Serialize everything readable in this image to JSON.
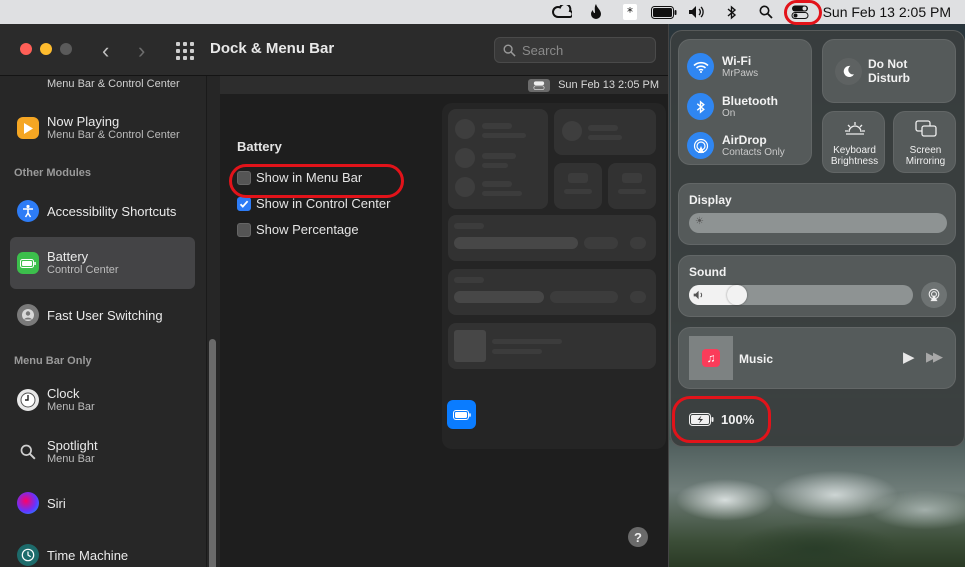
{
  "menubar": {
    "clock": "Sun Feb 13  2:05 PM",
    "icons": [
      "creative-cloud-icon",
      "flame-icon",
      "asterisk-icon",
      "battery-icon",
      "volume-icon",
      "bluetooth-icon",
      "search-icon",
      "control-center-icon"
    ]
  },
  "window": {
    "title": "Dock & Menu Bar",
    "search_placeholder": "Search"
  },
  "sidebar": {
    "items": [
      {
        "title": "",
        "subtitle": "Menu Bar & Control Center",
        "icon": "generic-icon"
      },
      {
        "title": "Now Playing",
        "subtitle": "Menu Bar & Control Center",
        "icon": "play-icon"
      },
      {
        "title": "Accessibility Shortcuts",
        "subtitle": "",
        "icon": "accessibility-icon"
      },
      {
        "title": "Battery",
        "subtitle": "Control Center",
        "icon": "battery-icon"
      },
      {
        "title": "Fast User Switching",
        "subtitle": "",
        "icon": "user-icon"
      },
      {
        "title": "Clock",
        "subtitle": "Menu Bar",
        "icon": "clock-icon"
      },
      {
        "title": "Spotlight",
        "subtitle": "Menu Bar",
        "icon": "search-icon"
      },
      {
        "title": "Siri",
        "subtitle": "",
        "icon": "siri-icon"
      },
      {
        "title": "Time Machine",
        "subtitle": "",
        "icon": "time-machine-icon"
      }
    ],
    "headers": {
      "other_modules": "Other Modules",
      "menu_bar_only": "Menu Bar Only"
    },
    "selected": "Battery"
  },
  "main": {
    "preview_clock": "Sun Feb 13  2:05 PM",
    "section_title": "Battery",
    "options": [
      {
        "label": "Show in Menu Bar",
        "checked": false
      },
      {
        "label": "Show in Control Center",
        "checked": true
      },
      {
        "label": "Show Percentage",
        "checked": false
      }
    ],
    "help": "?"
  },
  "control_center": {
    "wifi": {
      "title": "Wi-Fi",
      "sub": "MrPaws"
    },
    "bluetooth": {
      "title": "Bluetooth",
      "sub": "On"
    },
    "airdrop": {
      "title": "AirDrop",
      "sub": "Contacts Only"
    },
    "dnd": {
      "title": "Do Not Disturb"
    },
    "keyboard_brightness": {
      "title": "Keyboard Brightness"
    },
    "screen_mirroring": {
      "title": "Screen Mirroring"
    },
    "display": {
      "title": "Display",
      "level": 0.0
    },
    "sound": {
      "title": "Sound",
      "level": 0.22
    },
    "music": {
      "title": "Music"
    },
    "battery": {
      "percent": "100%"
    }
  },
  "colors": {
    "accent": "#2d7cf6",
    "highlight_ring": "#e2131a"
  }
}
